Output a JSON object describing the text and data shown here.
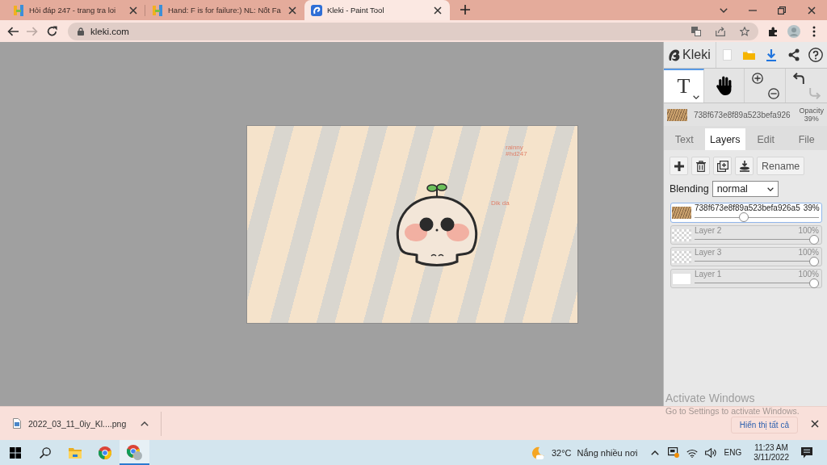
{
  "browser": {
    "tabs": [
      {
        "title": "Hỏi đáp 247 - trang tra loi",
        "selected": false
      },
      {
        "title": "Hand: F is for failure:) NL: Nốt Fa",
        "selected": false
      },
      {
        "title": "Kleki - Paint Tool",
        "selected": true
      }
    ],
    "nav": [
      {
        "kind": "back",
        "disabled": false
      },
      {
        "kind": "forward",
        "disabled": true
      },
      {
        "kind": "reload",
        "disabled": false
      }
    ],
    "address": {
      "url": "kleki.com"
    }
  },
  "kleki": {
    "logo": "Kleki",
    "tools": [
      {
        "kind": "text",
        "glyph": "T",
        "selected": true
      },
      {
        "kind": "hand",
        "selected": false
      }
    ],
    "history": [
      {
        "kind": "undo",
        "disabled": false
      },
      {
        "kind": "redo",
        "disabled": true
      }
    ],
    "current_layer": {
      "name": "738f673e8f89a523befa926",
      "opacity_label": "Opacity",
      "opacity": "39%"
    },
    "tabs": [
      {
        "label": "Text",
        "selected": false
      },
      {
        "label": "Layers",
        "selected": true
      },
      {
        "label": "Edit",
        "selected": false
      },
      {
        "label": "File",
        "selected": false
      }
    ],
    "rename_button": "Rename",
    "blending": {
      "label": "Blending",
      "value": "normal"
    },
    "layers": [
      {
        "name": "738f673e8f89a523befa926a5",
        "opacity": "39%",
        "level": 0.39,
        "selected": true
      },
      {
        "name": "Layer 2",
        "opacity": "100%",
        "level": 1,
        "selected": false
      },
      {
        "name": "Layer 3",
        "opacity": "100%",
        "level": 1,
        "selected": false
      },
      {
        "name": "Layer 1",
        "opacity": "100%",
        "level": 1,
        "selected": false
      }
    ]
  },
  "canvas": {
    "texts": [
      {
        "text": "rainny"
      },
      {
        "text": "#hd247"
      },
      {
        "text": "Dik da"
      }
    ]
  },
  "download_bar": {
    "file_name": "2022_03_11_0iy_Kl....png",
    "show_all": "Hiển thị tất cả"
  },
  "activation_notice": {
    "title": "Activate Windows",
    "message": "Go to Settings to activate Windows."
  },
  "taskbar": {
    "apps": [
      {
        "kind": "start",
        "active": false
      },
      {
        "kind": "search",
        "active": false
      },
      {
        "kind": "explorer",
        "active": false
      },
      {
        "kind": "chrome",
        "active": false
      },
      {
        "kind": "chrome_profile",
        "active": true
      }
    ],
    "weather": {
      "temperature": "32°C",
      "condition": "Nắng nhiều nơi"
    },
    "language": "ENG",
    "time": "11:23 AM",
    "date": "3/11/2022"
  }
}
